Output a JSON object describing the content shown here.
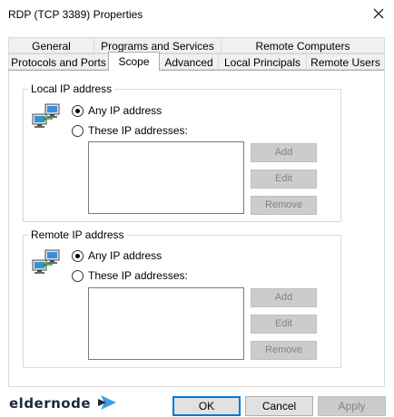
{
  "window": {
    "title": "RDP (TCP 3389) Properties",
    "close_icon": "close-icon"
  },
  "tabs": {
    "row1": [
      "General",
      "Programs and Services",
      "Remote Computers"
    ],
    "row2": [
      "Protocols and Ports",
      "Scope",
      "Advanced",
      "Local Principals",
      "Remote Users"
    ],
    "active": "Scope"
  },
  "local": {
    "legend": "Local IP address",
    "icon": "network-computers-icon",
    "radio_any": "Any IP address",
    "radio_these": "These IP addresses:",
    "selected": "any",
    "add": "Add",
    "edit": "Edit",
    "remove": "Remove"
  },
  "remote": {
    "legend": "Remote IP address",
    "icon": "network-computers-icon",
    "radio_any": "Any IP address",
    "radio_these": "These IP addresses:",
    "selected": "any",
    "add": "Add",
    "edit": "Edit",
    "remove": "Remove"
  },
  "footer": {
    "ok": "OK",
    "cancel": "Cancel",
    "apply": "Apply"
  },
  "watermark": {
    "text": "eldernode"
  },
  "colors": {
    "default_button_border": "#0078d7",
    "disabled_button_bg": "#cccccc",
    "disabled_text": "#838383",
    "brand_text": "#1b2a3e",
    "brand_accent": "#3aa0e6"
  }
}
